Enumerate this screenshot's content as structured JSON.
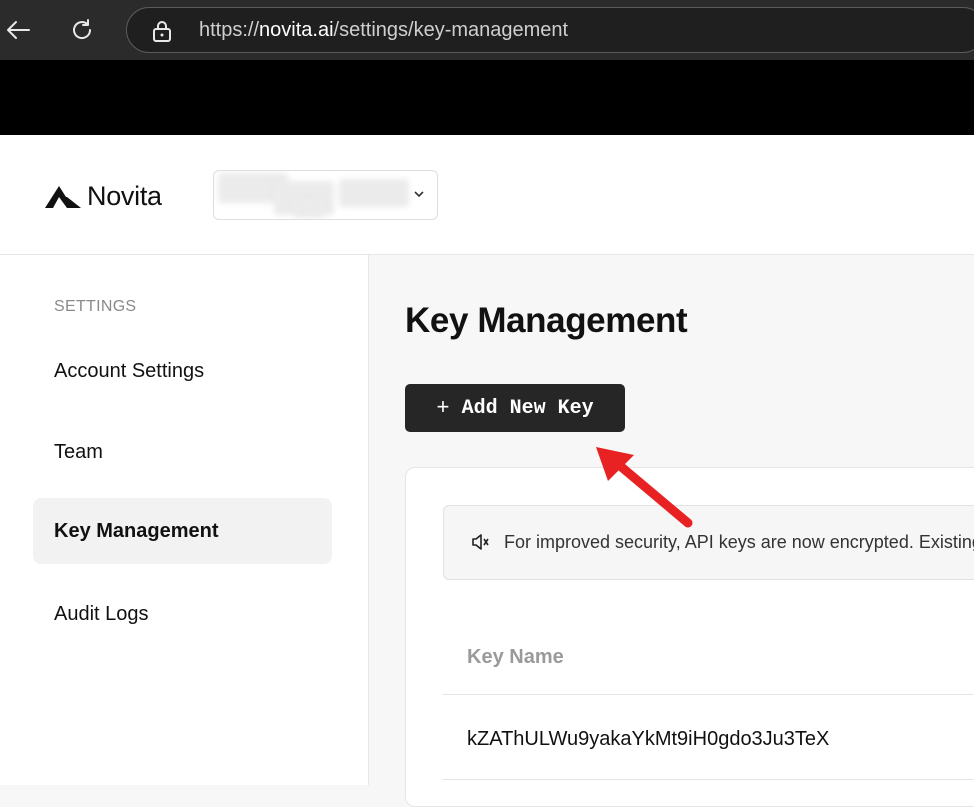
{
  "browser": {
    "url_scheme": "https://",
    "url_host": "novita.ai",
    "url_path": "/settings/key-management"
  },
  "header": {
    "brand": "Novita"
  },
  "sidebar": {
    "heading": "SETTINGS",
    "items": [
      {
        "label": "Account Settings",
        "active": false
      },
      {
        "label": "Team",
        "active": false
      },
      {
        "label": "Key Management",
        "active": true
      },
      {
        "label": "Audit Logs",
        "active": false
      }
    ]
  },
  "main": {
    "title": "Key Management",
    "add_button_label": "Add New Key",
    "notice": "For improved security, API keys are now encrypted. Existing",
    "table": {
      "columns": [
        "Key Name"
      ],
      "rows": [
        {
          "key_name": "kZAThULWu9yakaYkMt9iH0gdo3Ju3TeX"
        }
      ]
    }
  },
  "colors": {
    "accent_button": "#262626",
    "annotation_arrow": "#e82222"
  }
}
